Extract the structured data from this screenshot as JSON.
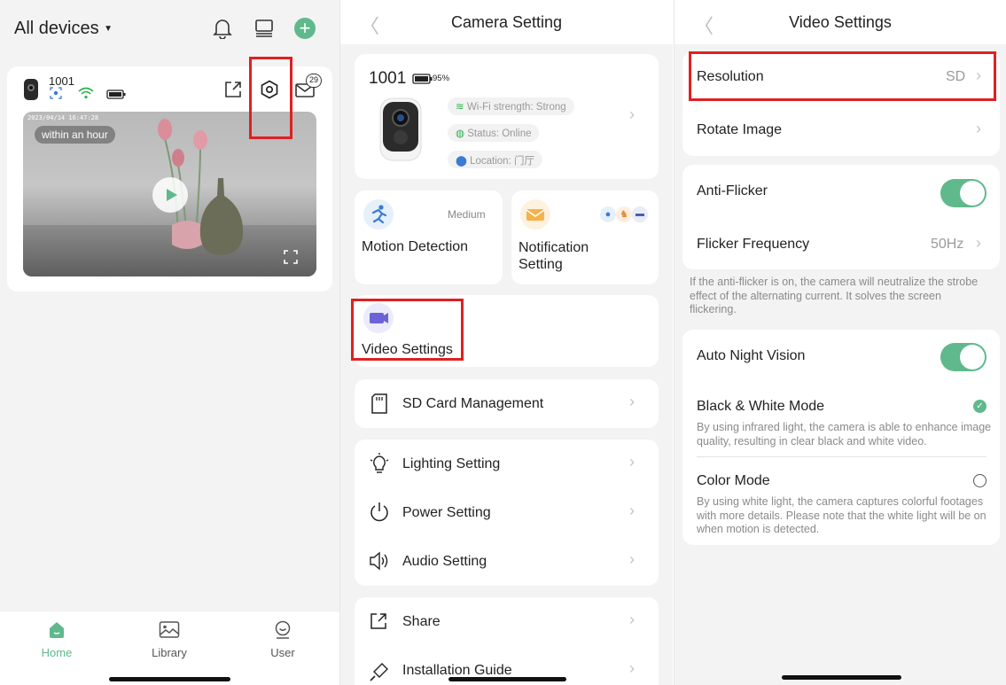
{
  "home": {
    "title": "All devices",
    "device": {
      "name": "1001",
      "timestamp": "2023/04/14 16:47:28",
      "badge": "within an hour",
      "message_count": "29"
    },
    "tabs": [
      {
        "label": "Home",
        "active": true
      },
      {
        "label": "Library",
        "active": false
      },
      {
        "label": "User",
        "active": false
      }
    ],
    "accent_color": "#5fb98c"
  },
  "camera_setting": {
    "title": "Camera Setting",
    "device_name": "1001",
    "battery": "95%",
    "pills": [
      "Wi-Fi strength: Strong",
      "Status: Online",
      "Location: 门厅"
    ],
    "motion": {
      "label": "Motion Detection",
      "level": "Medium"
    },
    "notification": {
      "label": "Notification Setting"
    },
    "video": {
      "label": "Video Settings"
    },
    "sd_card": "SD Card Management",
    "group2": [
      "Lighting Setting",
      "Power Setting",
      "Audio Setting"
    ],
    "group3": [
      "Share",
      "Installation Guide"
    ]
  },
  "video_settings": {
    "title": "Video Settings",
    "resolution": {
      "label": "Resolution",
      "value": "SD"
    },
    "rotate": {
      "label": "Rotate Image"
    },
    "anti_flicker": {
      "label": "Anti-Flicker",
      "on": true
    },
    "flicker_freq": {
      "label": "Flicker Frequency",
      "value": "50Hz"
    },
    "flicker_note": "If the anti-flicker is on, the camera will neutralize the strobe effect of the alternating current. It solves the screen flickering.",
    "night_vision": {
      "label": "Auto Night Vision",
      "on": true
    },
    "bw_mode": {
      "label": "Black & White Mode",
      "desc": "By using infrared light, the camera is able to enhance image quality, resulting in clear black and white video.",
      "selected": true
    },
    "color_mode": {
      "label": "Color Mode",
      "desc": "By using white light, the camera captures colorful footages with more details. Please note that the white light will be on when motion is detected.",
      "selected": false
    }
  }
}
